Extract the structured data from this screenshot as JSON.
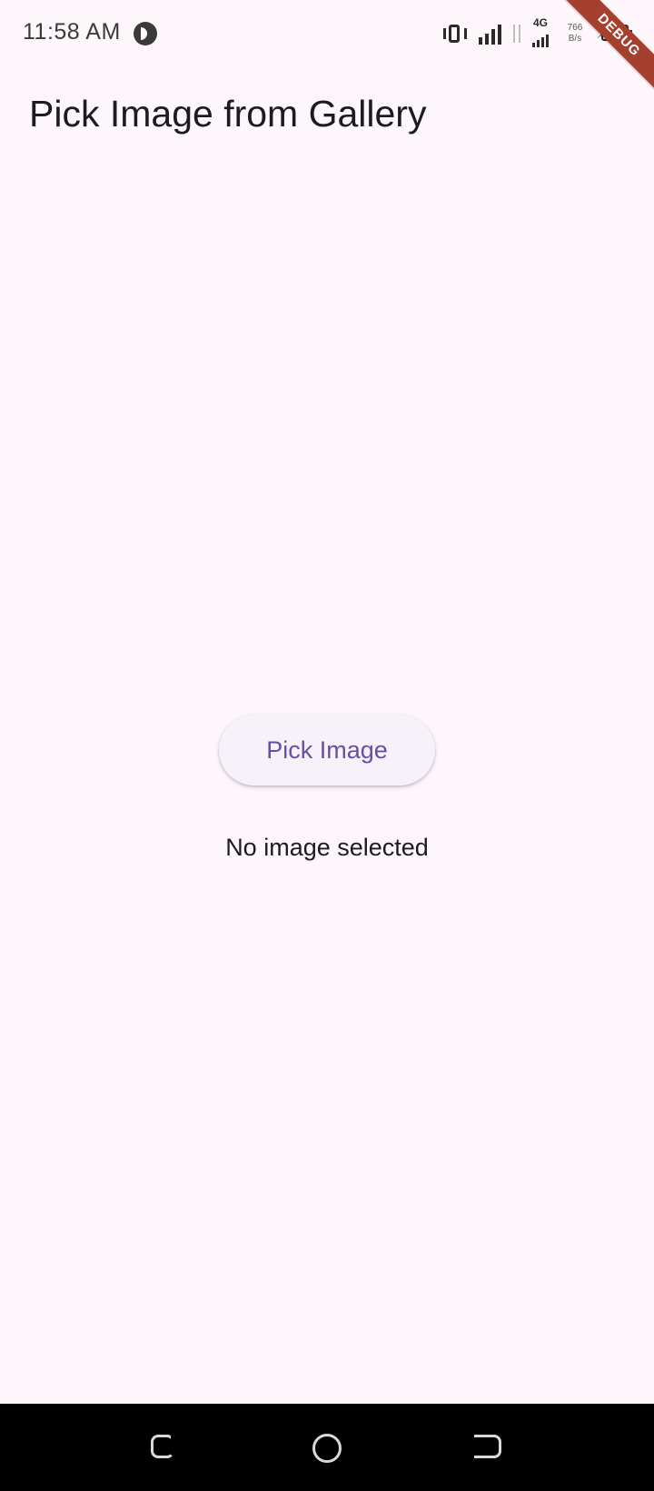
{
  "status_bar": {
    "time": "11:58 AM",
    "network_type": "4G",
    "speed_value": "766",
    "speed_unit": "B/s",
    "icons": [
      "app-notification-icon",
      "vibrate-icon",
      "signal-icon",
      "data-arrows-icon",
      "network-4g-icon",
      "battery-charging-icon"
    ]
  },
  "debug_banner": "DEBUG",
  "app_bar": {
    "title": "Pick Image from Gallery"
  },
  "main": {
    "pick_button_label": "Pick Image",
    "status_text": "No image selected"
  },
  "nav_bar": {
    "icons": [
      "recent-apps-icon",
      "home-icon",
      "back-icon"
    ]
  },
  "colors": {
    "background": "#fdf7fb",
    "primary": "#6750a4",
    "button_surface": "#f7f1f9",
    "debug_banner": "#a5402e",
    "nav_bar": "#000000"
  }
}
